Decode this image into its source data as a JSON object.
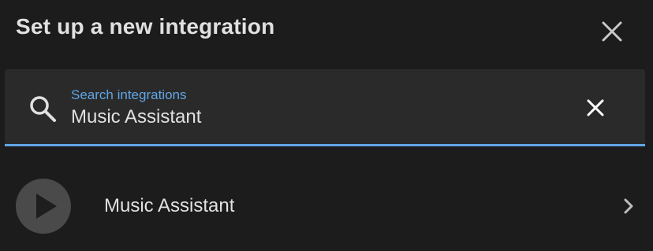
{
  "dialog": {
    "title": "Set up a new integration"
  },
  "search": {
    "label": "Search integrations",
    "value": "Music Assistant",
    "icon": "search-icon",
    "clear_icon": "clear-icon"
  },
  "results": [
    {
      "label": "Music Assistant",
      "logo_icon": "play-icon",
      "chevron_icon": "chevron-right-icon"
    }
  ],
  "colors": {
    "background": "#1c1c1c",
    "search_background": "#2a2a2a",
    "accent": "#61a5e6",
    "text": "#e1e1e1",
    "logo_background": "#4a4a4a"
  }
}
